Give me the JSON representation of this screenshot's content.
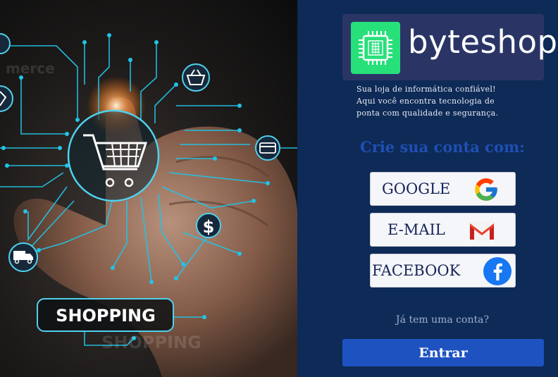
{
  "hero": {
    "banner_label": "SHOPPING",
    "reflection_label": "SHOPPING",
    "faded_text": "merce",
    "colors": {
      "circuit": "#22c3e6",
      "banner_border": "#4fd1ee"
    },
    "icons": [
      "cart-icon",
      "basket-icon",
      "card-icon",
      "dollar-icon",
      "truck-icon",
      "tag-icon"
    ]
  },
  "brand": {
    "name": "byteshop",
    "chip_color": "#27e07a",
    "tagline_lines": [
      "Sua loja de informática confiável!",
      "Aqui você encontra tecnologia de",
      "ponta com qualidade e segurança."
    ]
  },
  "signup": {
    "title": "Crie sua conta com:",
    "options": [
      {
        "label": "GOOGLE",
        "icon": "google-icon"
      },
      {
        "label": "E-MAIL",
        "icon": "gmail-icon"
      },
      {
        "label": "FACEBOOK",
        "icon": "facebook-icon"
      }
    ]
  },
  "login": {
    "prompt": "Já tem uma conta?",
    "button_label": "Entrar",
    "button_color": "#1f52c1"
  }
}
